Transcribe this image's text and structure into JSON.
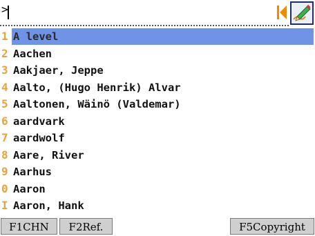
{
  "input": {
    "prompt": ">",
    "value": ""
  },
  "toolbar": {
    "first_icon": "skip-to-first-icon",
    "edit_icon": "handwriting-pen-icon",
    "accent_orange": "#f08a00",
    "selection_color": "#6f93e6"
  },
  "list": {
    "items": [
      {
        "num": "1",
        "word": "A level",
        "selected": true
      },
      {
        "num": "2",
        "word": "Aachen"
      },
      {
        "num": "3",
        "word": "Aakjaer, Jeppe"
      },
      {
        "num": "4",
        "word": "Aalto, (Hugo Henrik) Alvar"
      },
      {
        "num": "5",
        "word": "Aaltonen, Wäinö (Valdemar)"
      },
      {
        "num": "6",
        "word": "aardvark"
      },
      {
        "num": "7",
        "word": "aardwolf"
      },
      {
        "num": "8",
        "word": "Aare, River"
      },
      {
        "num": "9",
        "word": "Aarhus"
      },
      {
        "num": "0",
        "word": "Aaron"
      },
      {
        "num": "I",
        "word": "Aaron, Hank"
      }
    ]
  },
  "function_bar": {
    "f1": "F1CHN",
    "f2": "F2Ref.",
    "f5": "F5Copyright"
  }
}
